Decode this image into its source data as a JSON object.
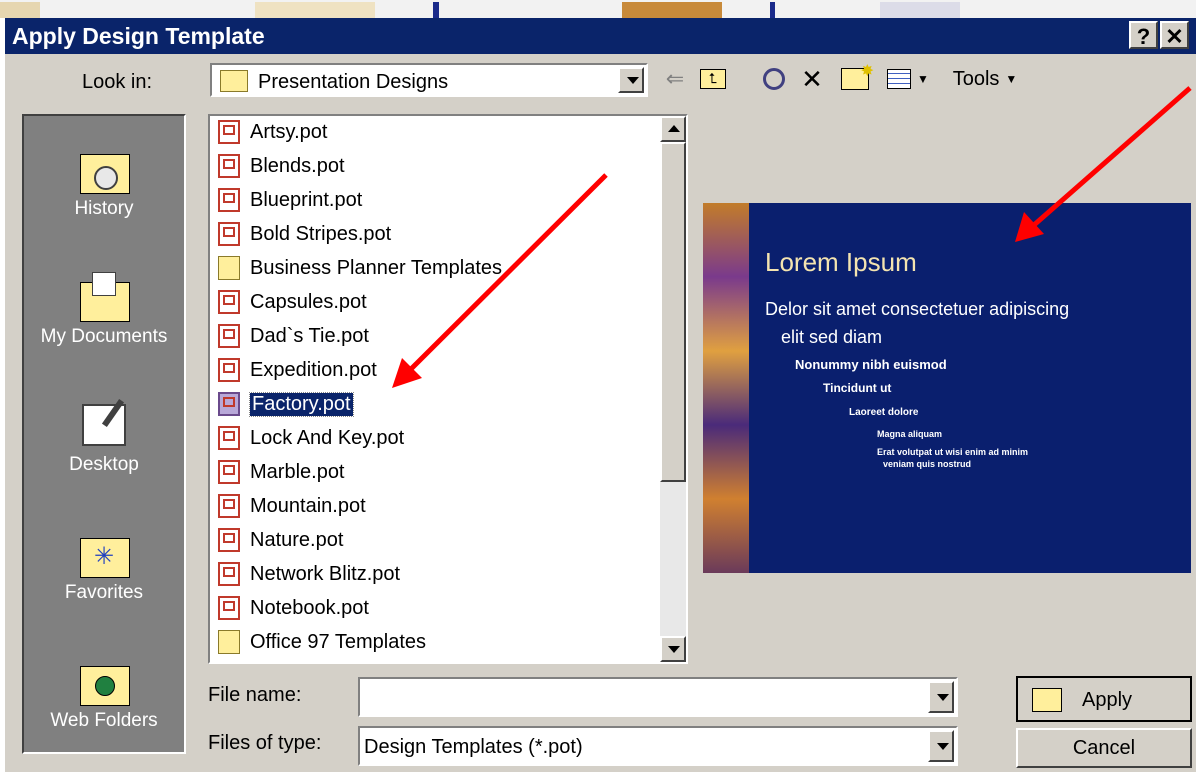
{
  "window": {
    "title": "Apply Design Template",
    "help_label": "?",
    "close_label": "✕"
  },
  "toolbar": {
    "look_in_label": "Look in:",
    "look_in_value": "Presentation Designs",
    "tools_label": "Tools"
  },
  "places": [
    {
      "label": "History",
      "icon": "history-icon"
    },
    {
      "label": "My Documents",
      "icon": "my-documents-icon"
    },
    {
      "label": "Desktop",
      "icon": "desktop-icon"
    },
    {
      "label": "Favorites",
      "icon": "favorites-icon"
    },
    {
      "label": "Web Folders",
      "icon": "web-folders-icon"
    }
  ],
  "files": [
    {
      "name": "Artsy.pot",
      "kind": "pot"
    },
    {
      "name": "Blends.pot",
      "kind": "pot"
    },
    {
      "name": "Blueprint.pot",
      "kind": "pot"
    },
    {
      "name": "Bold Stripes.pot",
      "kind": "pot"
    },
    {
      "name": "Business Planner Templates",
      "kind": "folder"
    },
    {
      "name": "Capsules.pot",
      "kind": "pot"
    },
    {
      "name": "Dad`s Tie.pot",
      "kind": "pot"
    },
    {
      "name": "Expedition.pot",
      "kind": "pot"
    },
    {
      "name": "Factory.pot",
      "kind": "pot",
      "selected": true
    },
    {
      "name": "Lock And Key.pot",
      "kind": "pot"
    },
    {
      "name": "Marble.pot",
      "kind": "pot"
    },
    {
      "name": "Mountain.pot",
      "kind": "pot"
    },
    {
      "name": "Nature.pot",
      "kind": "pot"
    },
    {
      "name": "Network Blitz.pot",
      "kind": "pot"
    },
    {
      "name": "Notebook.pot",
      "kind": "pot"
    },
    {
      "name": "Office 97 Templates",
      "kind": "folder"
    }
  ],
  "preview": {
    "title": "Lorem Ipsum",
    "bullet1a": "Delor sit amet consectetuer adipiscing",
    "bullet1b": "elit sed diam",
    "bullet2": "Nonummy nibh euismod",
    "bullet3": "Tincidunt ut",
    "bullet4": "Laoreet dolore",
    "bullet5": "Magna aliquam",
    "bullet6a": "Erat volutpat ut wisi enim ad minim",
    "bullet6b": "veniam quis nostrud"
  },
  "form": {
    "file_name_label": "File name:",
    "file_name_value": "",
    "file_type_label": "Files of type:",
    "file_type_value": "Design Templates (*.pot)",
    "apply_label": "Apply",
    "cancel_label": "Cancel"
  },
  "colors": {
    "titlebar": "#0a246a",
    "annotation_arrow": "#ff0000"
  }
}
